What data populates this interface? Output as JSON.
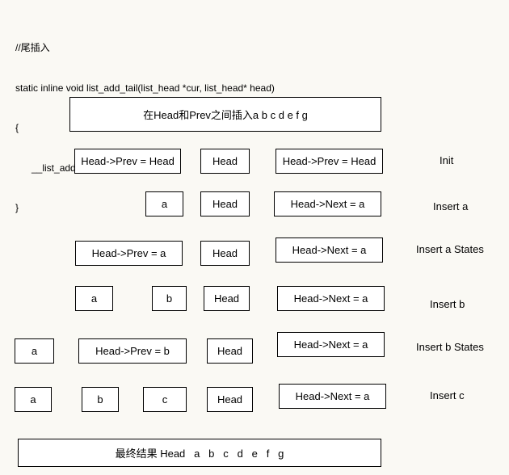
{
  "code": {
    "lines": [
      "//尾插入",
      "static inline void list_add_tail(list_head *cur, list_head* head)",
      "{",
      "      __list_add(cur,head->Prev,head);",
      "}"
    ]
  },
  "title_box": "在Head和Prev之间插入a b c d e f g",
  "rows": {
    "init": {
      "boxes": [
        "Head->Prev = Head",
        "Head",
        "Head->Prev = Head"
      ],
      "label": "Init"
    },
    "insert_a": {
      "boxes": [
        "a",
        "Head",
        "Head->Next = a"
      ],
      "label": "Insert a"
    },
    "insert_a_states": {
      "boxes": [
        "Head->Prev = a",
        "Head",
        "Head->Next = a"
      ],
      "label": "Insert a States"
    },
    "insert_b": {
      "boxes": [
        "a",
        "b",
        "Head",
        "Head->Next = a"
      ],
      "label": "Insert b"
    },
    "insert_b_states": {
      "boxes": [
        "a",
        "Head->Prev = b",
        "Head",
        "Head->Next = a"
      ],
      "label": "Insert b States"
    },
    "insert_c": {
      "boxes": [
        "a",
        "b",
        "c",
        "Head",
        "Head->Next = a"
      ],
      "label": "Insert c"
    }
  },
  "result_box": "最终结果 Head   a   b   c   d   e   f   g"
}
